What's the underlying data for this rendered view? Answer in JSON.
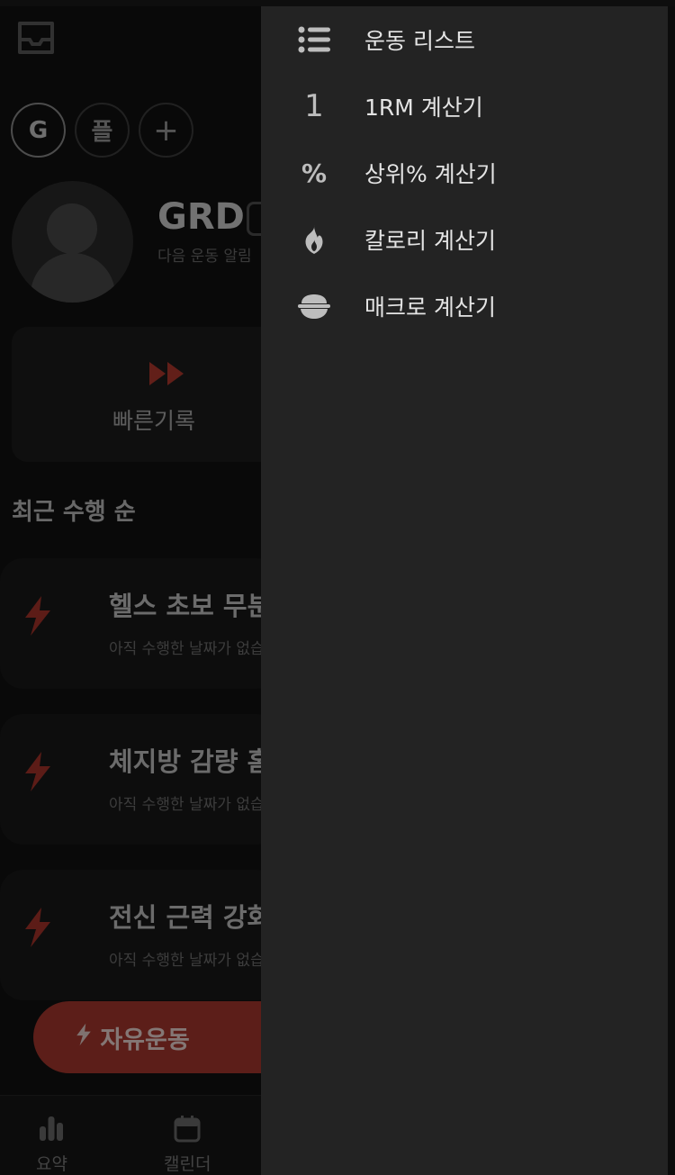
{
  "profiles": [
    {
      "label": "G",
      "active": true
    },
    {
      "label": "플",
      "active": false
    }
  ],
  "add_profile_symbol": "+",
  "user": {
    "name": "GRD",
    "next_workout": "다음 운동 알림"
  },
  "quick_record": {
    "label": "빠른기록"
  },
  "section_title": "최근 수행 순",
  "routines": [
    {
      "title": "헬스 초보 무분할",
      "subtitle": "아직 수행한 날짜가 없습니다"
    },
    {
      "title": "체지방 감량 홈트",
      "subtitle": "아직 수행한 날짜가 없습니다"
    },
    {
      "title": "전신 근력 강화",
      "subtitle": "아직 수행한 날짜가 없습니다"
    }
  ],
  "free_workout": {
    "label": "자유운동"
  },
  "bottom_nav": [
    {
      "label": "요약",
      "icon": "bar-chart-icon"
    },
    {
      "label": "캘린더",
      "icon": "calendar-icon"
    }
  ],
  "drawer": {
    "items": [
      {
        "label": "운동 리스트",
        "icon": "list-icon",
        "icon_text": ""
      },
      {
        "label": "1RM 계산기",
        "icon": "one-icon",
        "icon_text": "1"
      },
      {
        "label": "상위% 계산기",
        "icon": "percent-icon",
        "icon_text": "%"
      },
      {
        "label": "칼로리 계산기",
        "icon": "fire-icon",
        "icon_text": ""
      },
      {
        "label": "매크로 계산기",
        "icon": "rice-bowl-icon",
        "icon_text": ""
      }
    ]
  },
  "colors": {
    "accent": "#c0392b",
    "drawer_bg": "#232323",
    "background": "#121212"
  }
}
